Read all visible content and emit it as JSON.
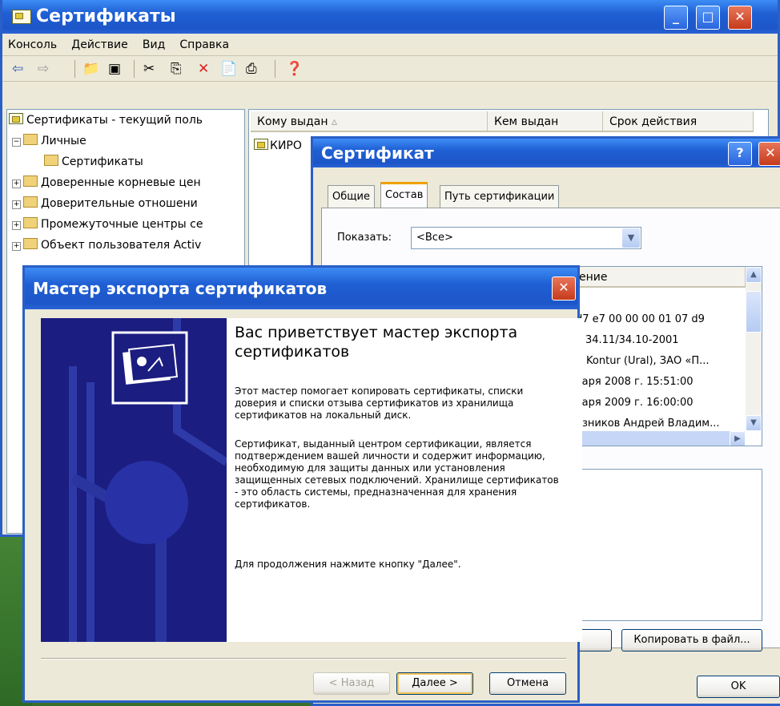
{
  "mmc": {
    "title": "Сертификаты",
    "menu": [
      "Консоль",
      "Действие",
      "Вид",
      "Справка"
    ],
    "tree": {
      "root": "Сертификаты - текущий поль",
      "personal": "Личные",
      "certificates": "Сертификаты",
      "trusted_root": "Доверенные корневые цен",
      "enterprise_trust": "Доверительные отношени",
      "intermediate": "Промежуточные центры се",
      "ad_user": "Объект пользователя Activ"
    },
    "list": {
      "columns": [
        "Кому выдан",
        "Кем выдан",
        "Срок действия"
      ],
      "row_issued_to": "КИРО"
    }
  },
  "cert_dialog": {
    "title": "Сертификат",
    "tabs": [
      "Общие",
      "Состав",
      "Путь сертификации"
    ],
    "show_label": "Показать:",
    "show_value": "<Все>",
    "value_column": "ение",
    "values": [
      "d7 e7 00 00 00 01 07 d9",
      "Р 34.11/34.10-2001",
      "B Kontur (Ural), ЗАО «П...",
      "варя 2008 г. 15:51:00",
      "варя 2009 г. 16:00:00",
      "езников Андрей Владим..."
    ],
    "copy_button": "Копировать в файл...",
    "ok_button": "OK"
  },
  "wizard": {
    "title": "Мастер экспорта сертификатов",
    "heading": "Вас приветствует мастер экспорта сертификатов",
    "para1": "Этот мастер помогает копировать сертификаты, списки доверия и списки отзыва сертификатов из хранилища сертификатов на локальный диск.",
    "para2": "Сертификат, выданный центром сертификации, является подтверждением вашей личности и содержит информацию, необходимую для защиты данных или установления защищенных сетевых подключений. Хранилище сертификатов - это область системы, предназначенная для хранения сертификатов.",
    "para3": "Для продолжения нажмите кнопку \"Далее\".",
    "back_button": "< Назад",
    "next_button": "Далее >",
    "cancel_button": "Отмена"
  }
}
